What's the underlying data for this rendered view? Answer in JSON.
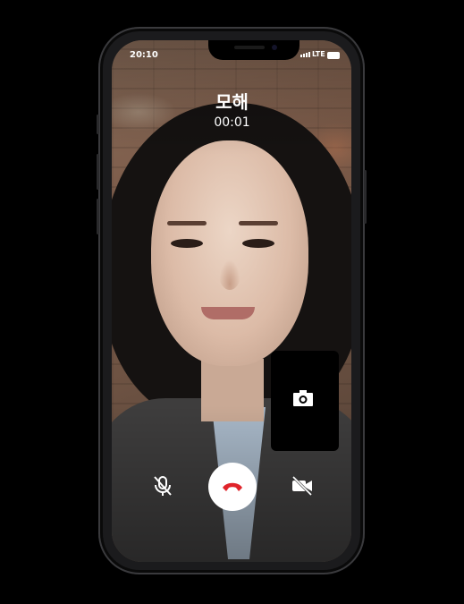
{
  "status_bar": {
    "time": "20:10",
    "network": "LTE",
    "signal_icon": "signal-bars-icon",
    "battery_icon": "battery-icon"
  },
  "call": {
    "caller_name": "모해",
    "duration": "00:01"
  },
  "controls": {
    "mute_icon": "microphone-off-icon",
    "end_call_icon": "phone-hangup-icon",
    "video_off_icon": "video-off-icon",
    "self_view_icon": "camera-icon"
  },
  "colors": {
    "end_call_accent": "#e0242b",
    "overlay_text": "#ffffff",
    "self_view_bg": "#000000"
  }
}
